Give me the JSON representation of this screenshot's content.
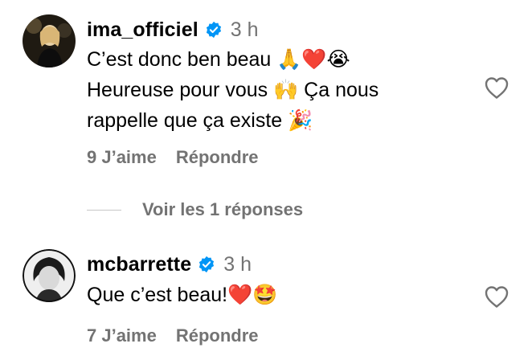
{
  "comments": [
    {
      "username": "ima_officiel",
      "time": "3 h",
      "lines": [
        {
          "text": "C’est donc ben beau ",
          "emoji": "🙏❤️😭"
        },
        {
          "text": "Heureuse pour vous ",
          "emoji": "🙌",
          "text2": " Ça nous"
        },
        {
          "text": "rappelle que ça existe ",
          "emoji": "🎉"
        }
      ],
      "likes": "9 J’aime",
      "reply": "Répondre",
      "avatar_icon": "profile-photo"
    },
    {
      "username": "mcbarrette",
      "time": "3 h",
      "lines": [
        {
          "text": "Que c’est beau!",
          "emoji": "❤️🤩"
        }
      ],
      "likes": "7 J’aime",
      "reply": "Répondre",
      "avatar_icon": "profile-photo"
    }
  ],
  "replies_toggle": "Voir les 1 réponses",
  "colors": {
    "secondary_text": "#737373",
    "verified_badge": "#0095f6",
    "heart_outline": "#737373"
  },
  "icons": [
    "verified-badge-icon",
    "heart-outline-icon"
  ]
}
